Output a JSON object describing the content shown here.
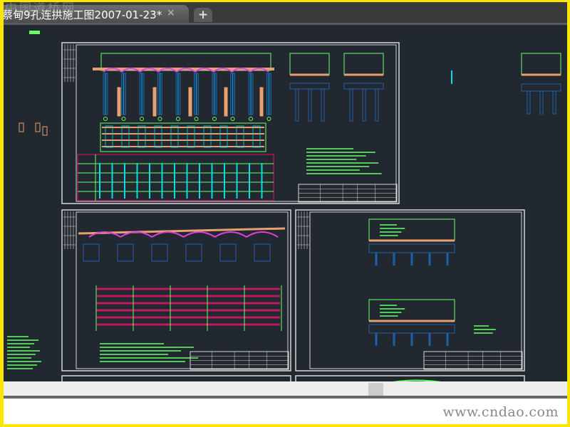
{
  "tab": {
    "title": "蔡甸9孔连拱施工图2007-01-23*",
    "close_icon": "×",
    "new_tab_icon": "+"
  },
  "watermark_top": "中国道桥网",
  "footer": {
    "site": "www.cndao.com"
  },
  "colors": {
    "background": "#212830",
    "green": "#66ff66",
    "cyan": "#00e0e0",
    "magenta": "#e040e0",
    "orange": "#e8a070",
    "blue": "#1f5fa8",
    "border": "#d8d8d8",
    "frame": "#ffe600"
  }
}
